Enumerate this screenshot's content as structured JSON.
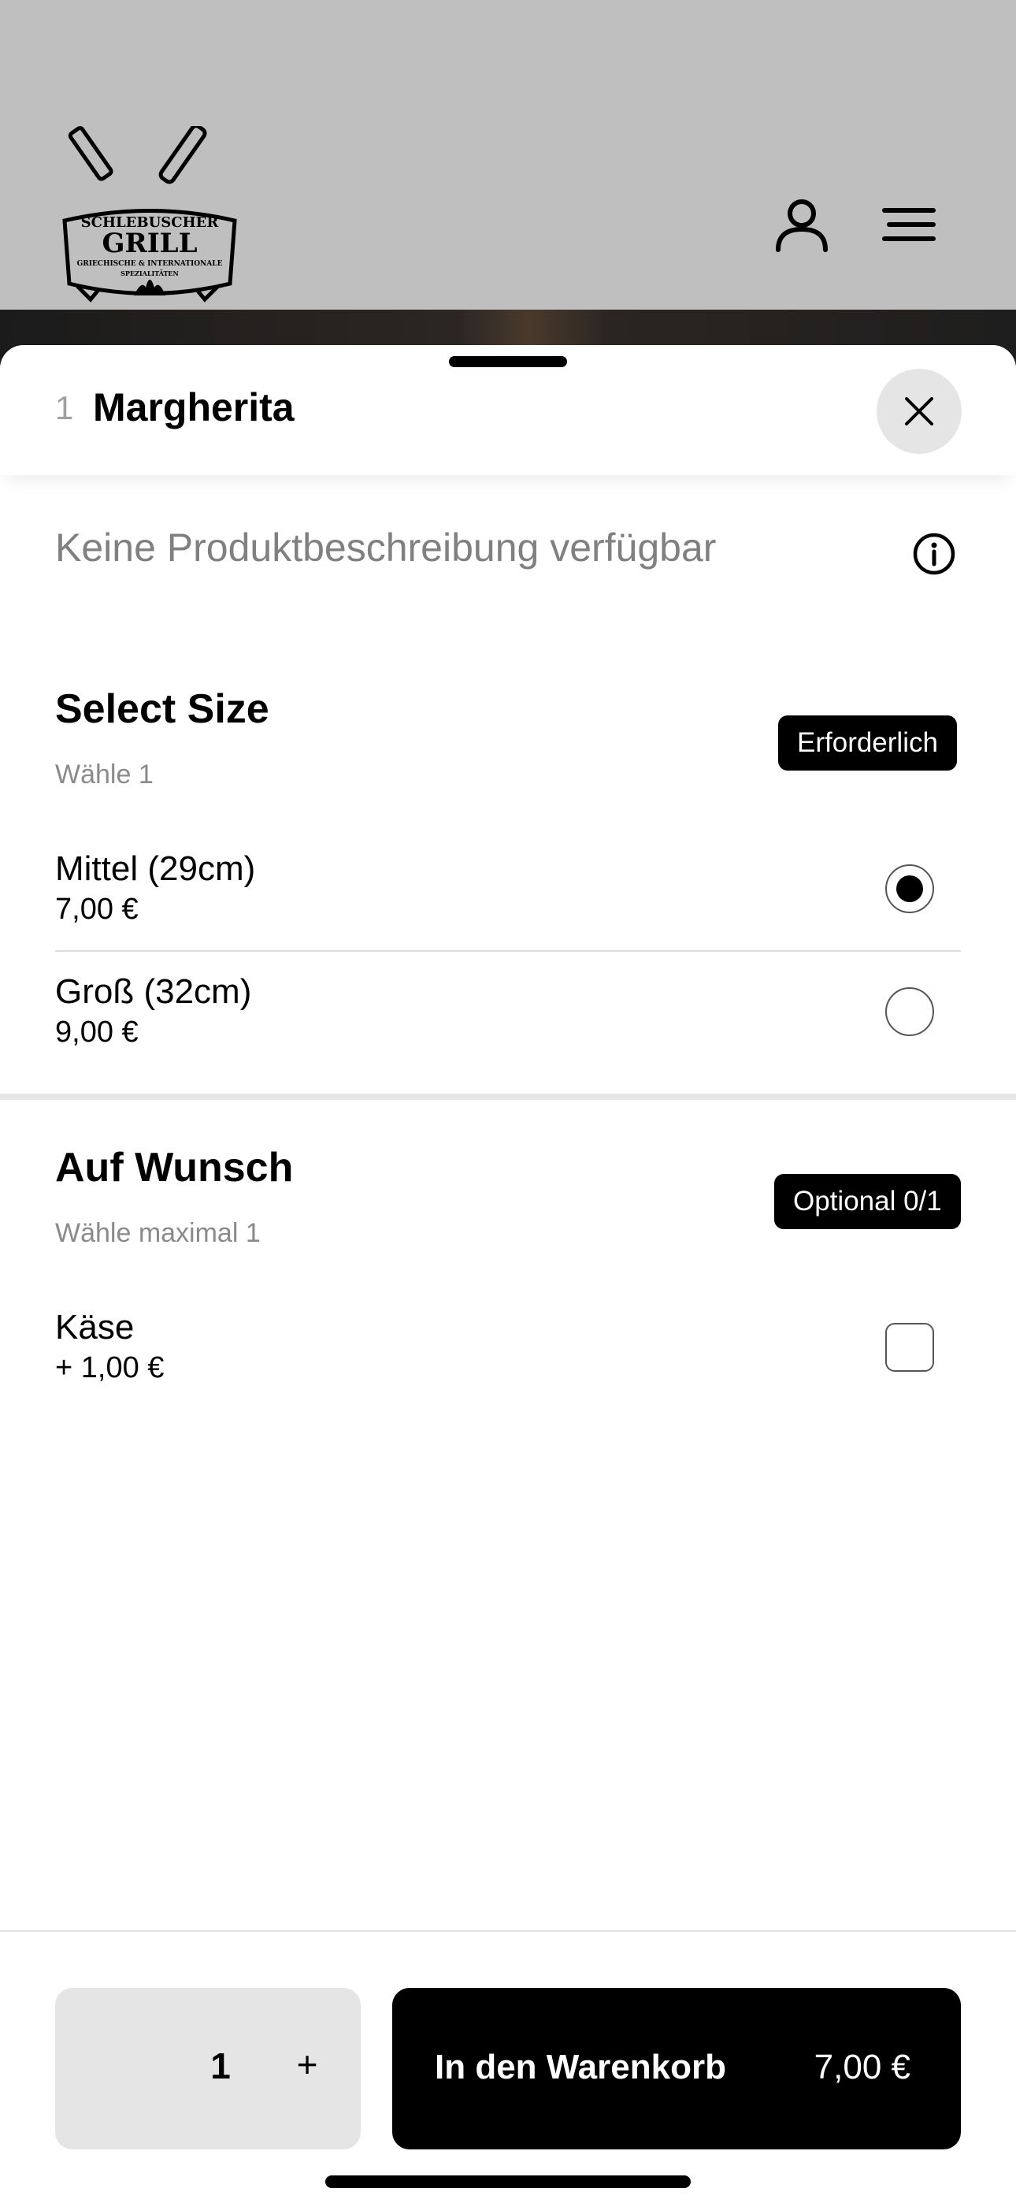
{
  "header": {
    "logo": {
      "line1": "SCHLEBUSCHER",
      "line2": "GRILL",
      "line3": "GRIECHISCHE & INTERNATIONALE",
      "line4": "SPEZIALITÄTEN"
    },
    "icons": [
      "user-icon",
      "menu-icon"
    ]
  },
  "product": {
    "number": "1",
    "title": "Margherita",
    "description": "Keine Produktbeschreibung verfügbar"
  },
  "sections": [
    {
      "title": "Select Size",
      "subtitle": "Wähle 1",
      "badge": "Erforderlich",
      "options": [
        {
          "name": "Mittel (29cm)",
          "price": "7,00 €",
          "selected": true
        },
        {
          "name": "Groß (32cm)",
          "price": "9,00 €",
          "selected": false
        }
      ]
    },
    {
      "title": "Auf Wunsch",
      "subtitle": "Wähle maximal 1",
      "badge": "Optional 0/1",
      "options": [
        {
          "name": "Käse",
          "price": "+ 1,00 €",
          "selected": false
        }
      ]
    }
  ],
  "footer": {
    "quantity": "1",
    "plus": "+",
    "cart_label": "In den Warenkorb",
    "cart_price": "7,00 €"
  }
}
